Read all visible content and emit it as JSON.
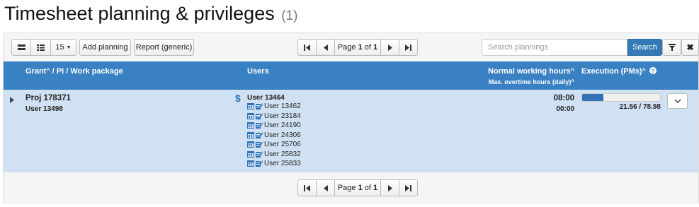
{
  "page": {
    "title": "Timesheet planning & privileges",
    "count": "(1)"
  },
  "toolbar": {
    "page_size": "15",
    "add_label": "Add planning",
    "report_label": "Report (generic)",
    "search_placeholder": "Search plannings",
    "search_label": "Search"
  },
  "pager": {
    "prefix": "Page",
    "page": "1",
    "sep": "of",
    "total": "1"
  },
  "table": {
    "headers": {
      "grant": "Grant",
      "grant_rest": " / PI / Work package",
      "users": "Users",
      "normal": "Normal working hours",
      "overtime": "Max. overtime hours (daily)",
      "execution": "Execution (PMs)"
    },
    "row": {
      "project": "Proj 178371",
      "pi": "User 13498",
      "currency_icon": "$",
      "main_user": "User 13464",
      "sub_users": [
        "User 13462",
        "User 23184",
        "User 24190",
        "User 24306",
        "User 25706",
        "User 25832",
        "User 25833"
      ],
      "normal_hours": "08:00",
      "overtime_hours": "00:00",
      "execution_value": "21.56 / 78.98",
      "execution_fraction": 0.273
    }
  },
  "colors": {
    "header_bg": "#3a81c4",
    "row_bg": "#d0e1f3",
    "accent": "#337ab7",
    "currency": "#2f72b5"
  }
}
